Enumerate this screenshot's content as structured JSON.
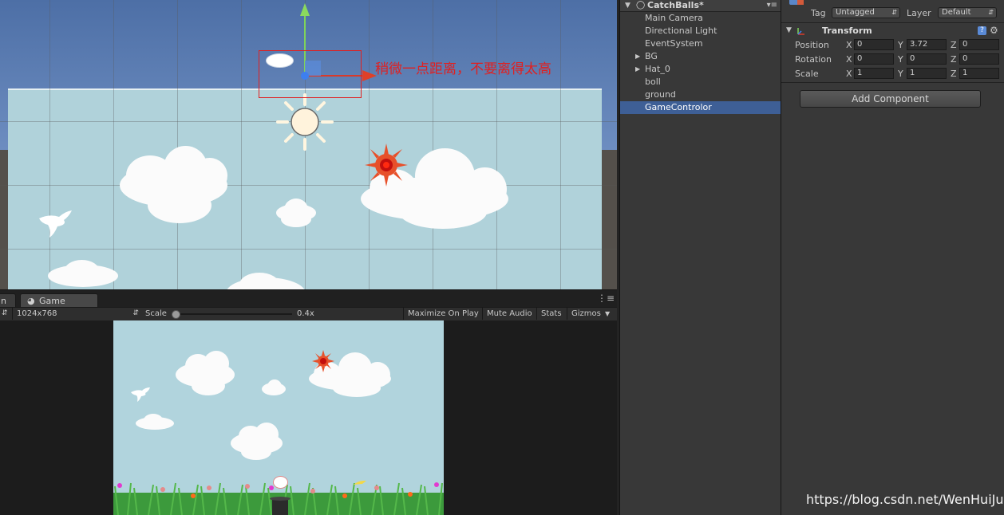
{
  "scene": {
    "annotation": "稍微一点距离，不要离得太高"
  },
  "game_panel": {
    "tab_prev_partial": "n",
    "tab_label": "Game",
    "tab_menu_icon": "menu-icon",
    "resolution": "1024x768",
    "scale_label": "Scale",
    "scale_value": "0.4x",
    "scale_fraction": 0.0,
    "maximize_on_play": "Maximize On Play",
    "mute_audio": "Mute Audio",
    "stats": "Stats",
    "gizmos": "Gizmos"
  },
  "hierarchy": {
    "scene_name": "CatchBalls*",
    "items": [
      {
        "label": "Main Camera",
        "has_children": false,
        "selected": false
      },
      {
        "label": "Directional Light",
        "has_children": false,
        "selected": false
      },
      {
        "label": "EventSystem",
        "has_children": false,
        "selected": false
      },
      {
        "label": "BG",
        "has_children": true,
        "selected": false
      },
      {
        "label": "Hat_0",
        "has_children": true,
        "selected": false
      },
      {
        "label": "boll",
        "has_children": false,
        "selected": false
      },
      {
        "label": "ground",
        "has_children": false,
        "selected": false
      },
      {
        "label": "GameControlor",
        "has_children": false,
        "selected": true
      }
    ]
  },
  "inspector": {
    "tag_label": "Tag",
    "tag_value": "Untagged",
    "layer_label": "Layer",
    "layer_value": "Default",
    "component_title": "Transform",
    "position": {
      "label": "Position",
      "x": "0",
      "y": "3.72",
      "z": "0"
    },
    "rotation": {
      "label": "Rotation",
      "x": "0",
      "y": "0",
      "z": "0"
    },
    "scale": {
      "label": "Scale",
      "x": "1",
      "y": "1",
      "z": "1"
    },
    "axis_x": "X",
    "axis_y": "Y",
    "axis_z": "Z",
    "add_component": "Add Component"
  },
  "watermark": "https://blog.csdn.net/WenHuiJun_",
  "colors": {
    "selection": "#3e5f96",
    "annotation_red": "#e02020",
    "panel_bg": "#383838",
    "sky": "#b0d2da"
  }
}
